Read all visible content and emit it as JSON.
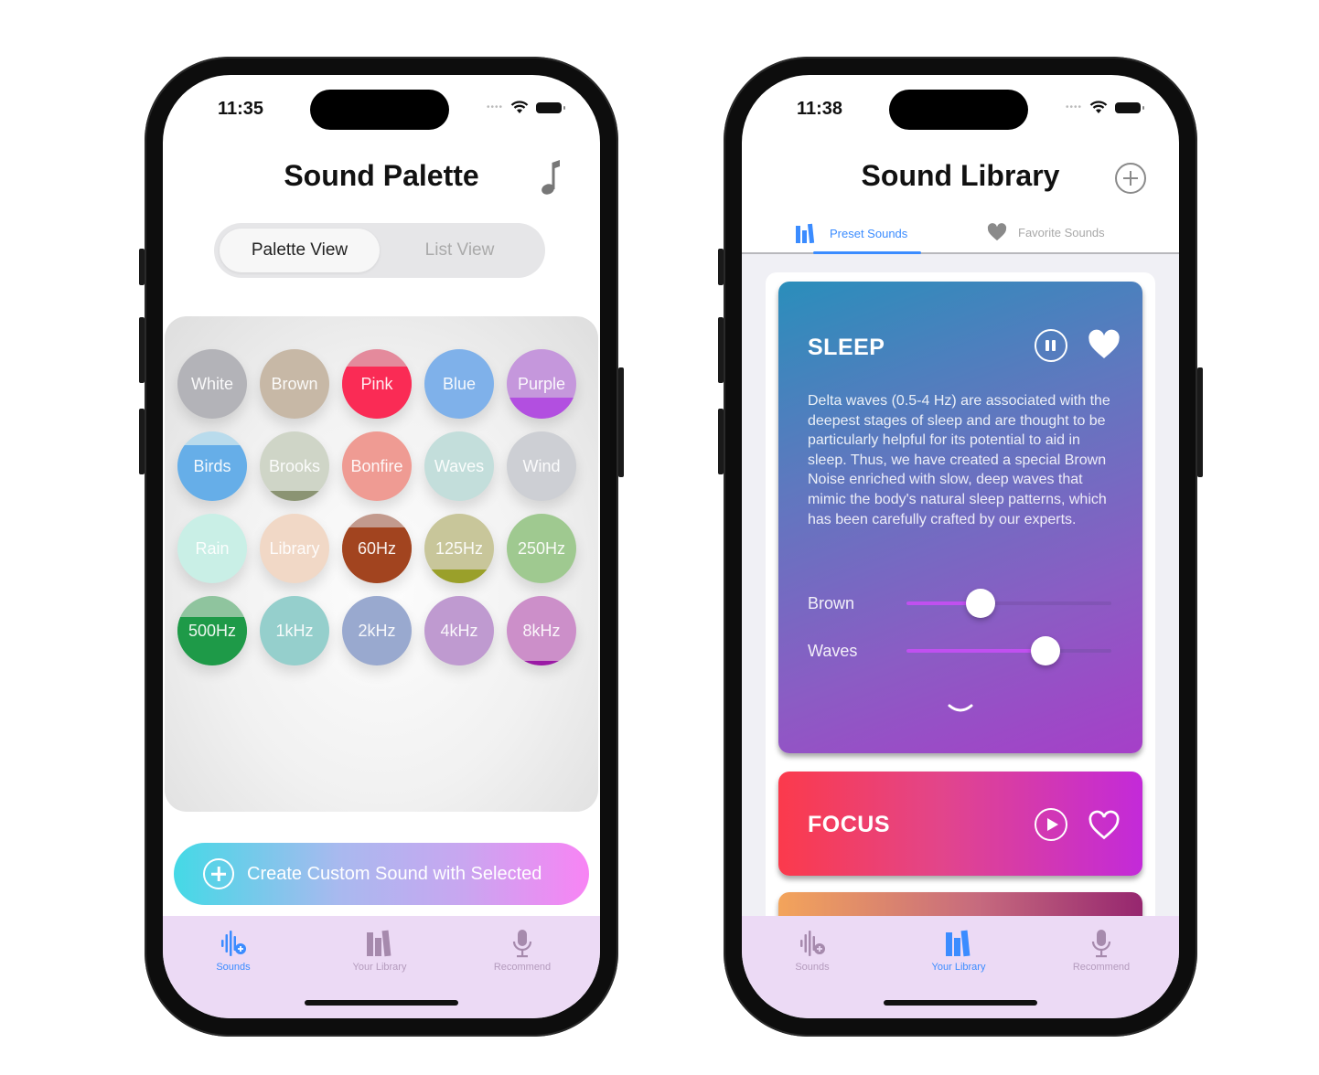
{
  "left_phone": {
    "status": {
      "time": "11:35"
    },
    "title": "Sound Palette",
    "segmented": {
      "options": [
        "Palette View",
        "List View"
      ],
      "selected": "Palette View"
    },
    "sounds": [
      {
        "label": "White",
        "color": "#b3b3b8",
        "fill_color": "#b3b3b8",
        "fill_level": 0
      },
      {
        "label": "Brown",
        "color": "#c7b8a6",
        "fill_color": "#c7b8a6",
        "fill_level": 0
      },
      {
        "label": "Pink",
        "color": "#e48a9c",
        "fill_color": "#fa2b55",
        "fill_level": 0.75
      },
      {
        "label": "Blue",
        "color": "#7fb1ea",
        "fill_color": "#7fb1ea",
        "fill_level": 0
      },
      {
        "label": "Purple",
        "color": "#c597dc",
        "fill_color": "#b24fe0",
        "fill_level": 0.3
      },
      {
        "label": "Birds",
        "color": "#b9dbec",
        "fill_color": "#66aee8",
        "fill_level": 0.8
      },
      {
        "label": "Brooks",
        "color": "#cfd5c7",
        "fill_color": "#8b9473",
        "fill_level": 0.15
      },
      {
        "label": "Bonfire",
        "color": "#ef9b93",
        "fill_color": "#ef9b93",
        "fill_level": 0
      },
      {
        "label": "Waves",
        "color": "#c3dedb",
        "fill_color": "#c3dedb",
        "fill_level": 0
      },
      {
        "label": "Wind",
        "color": "#cdcfd4",
        "fill_color": "#cdcfd4",
        "fill_level": 0
      },
      {
        "label": "Rain",
        "color": "#c9efe6",
        "fill_color": "#c9efe6",
        "fill_level": 0
      },
      {
        "label": "Library",
        "color": "#f1d8c6",
        "fill_color": "#f1d8c6",
        "fill_level": 0
      },
      {
        "label": "60Hz",
        "color": "#c29a8d",
        "fill_color": "#a2441f",
        "fill_level": 0.8
      },
      {
        "label": "125Hz",
        "color": "#c8c69a",
        "fill_color": "#9aa02a",
        "fill_level": 0.2
      },
      {
        "label": "250Hz",
        "color": "#9fc990",
        "fill_color": "#9fc990",
        "fill_level": 0
      },
      {
        "label": "500Hz",
        "color": "#8fc49e",
        "fill_color": "#1e9a48",
        "fill_level": 0.7
      },
      {
        "label": "1kHz",
        "color": "#95cfcc",
        "fill_color": "#95cfcc",
        "fill_level": 0
      },
      {
        "label": "2kHz",
        "color": "#99a9cf",
        "fill_color": "#99a9cf",
        "fill_level": 0
      },
      {
        "label": "4kHz",
        "color": "#bf9ad0",
        "fill_color": "#bf9ad0",
        "fill_level": 0
      },
      {
        "label": "8kHz",
        "color": "#cc8fc9",
        "fill_color": "#9a1aa5",
        "fill_level": 0.06
      }
    ],
    "create_button": "Create Custom Sound with Selected",
    "tabbar": {
      "items": [
        "Sounds",
        "Your Library",
        "Recommend"
      ],
      "active": "Sounds"
    }
  },
  "right_phone": {
    "status": {
      "time": "11:38"
    },
    "title": "Sound Library",
    "tabs": {
      "items": [
        "Preset Sounds",
        "Favorite Sounds"
      ],
      "active": "Preset Sounds"
    },
    "cards": [
      {
        "title": "SLEEP",
        "playing": true,
        "favorite": true,
        "description": "Delta waves (0.5-4 Hz) are associated with the deepest stages of sleep and are thought to be particularly helpful for its potential to aid in sleep. Thus, we have created a special Brown Noise enriched with slow, deep waves that mimic the body's natural sleep patterns, which has been carefully crafted by our experts.",
        "sliders": [
          {
            "label": "Brown",
            "value": 0.36
          },
          {
            "label": "Waves",
            "value": 0.68
          }
        ]
      },
      {
        "title": "FOCUS",
        "playing": false,
        "favorite": false
      }
    ],
    "tabbar": {
      "items": [
        "Sounds",
        "Your Library",
        "Recommend"
      ],
      "active": "Your Library"
    }
  },
  "colors": {
    "accent_blue": "#3b8cff",
    "tabbar_bg": "#ecdaf5",
    "tab_inactive": "#b49bbd"
  }
}
